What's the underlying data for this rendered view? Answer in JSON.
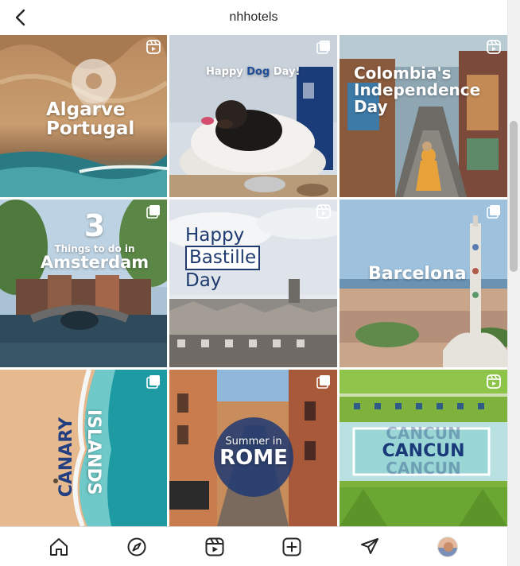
{
  "header": {
    "title": "nhhotels",
    "back_icon": "chevron-left-icon"
  },
  "posts": [
    {
      "id": "algarve",
      "caption_line1": "Algarve",
      "caption_line2": "Portugal",
      "badge": "reels-icon"
    },
    {
      "id": "dog-day",
      "caption_pre": "Happy ",
      "caption_accent": "Dog",
      "caption_post": " Day!",
      "badge": "carousel-icon",
      "accent_color": "#1f4e9a"
    },
    {
      "id": "colombia",
      "caption_line1": "Colombia's",
      "caption_line2": "Independence",
      "caption_line3": "Day",
      "badge": "reels-icon"
    },
    {
      "id": "amsterdam",
      "caption_num": "3",
      "caption_line1": "Things to do in",
      "caption_line2": "Amsterdam",
      "badge": "carousel-icon"
    },
    {
      "id": "bastille",
      "caption_line1": "Happy",
      "caption_line2": "Bastille",
      "caption_line3": "Day",
      "badge": "reels-icon",
      "text_color": "#1e3a6e"
    },
    {
      "id": "barcelona",
      "caption_line1": "Barcelona",
      "badge": "carousel-icon"
    },
    {
      "id": "canary",
      "caption_line1": "CANARY",
      "caption_line2": "ISLANDS",
      "badge": "carousel-icon",
      "text_color": "#233f82"
    },
    {
      "id": "rome",
      "caption_line1": "Summer in",
      "caption_line2": "ROME",
      "badge": "carousel-icon"
    },
    {
      "id": "cancun",
      "caption_line1": "CANCUN",
      "caption_line2": "CANCUN",
      "caption_line3": "CANCUN",
      "badge": "reels-icon",
      "text_color": "#1a3a7a"
    }
  ],
  "bottom_nav": [
    {
      "name": "home-icon",
      "label": "Home"
    },
    {
      "name": "explore-compass-icon",
      "label": "Explore"
    },
    {
      "name": "reels-icon",
      "label": "Reels"
    },
    {
      "name": "new-post-icon",
      "label": "New post"
    },
    {
      "name": "direct-messages-icon",
      "label": "Direct"
    },
    {
      "name": "profile-avatar",
      "label": "Profile"
    }
  ]
}
